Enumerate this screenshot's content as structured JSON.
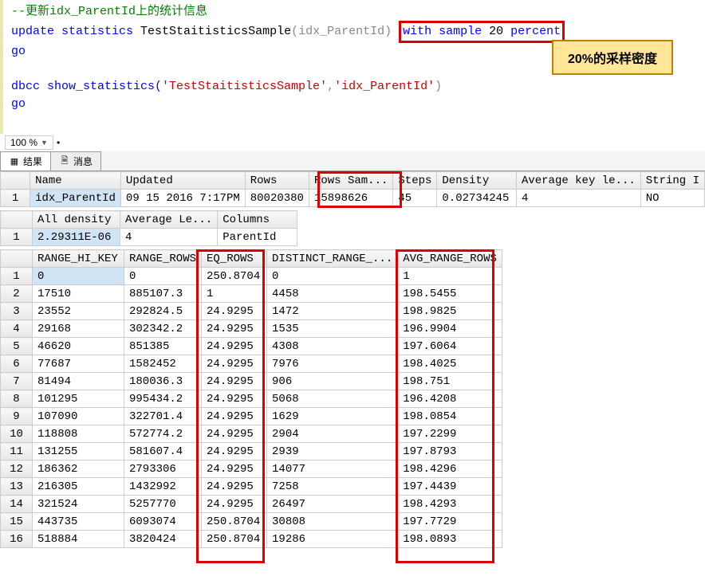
{
  "code": {
    "comment": "--更新idx_ParentId上的统计信息",
    "l2_a": "update",
    "l2_b": " statistics",
    "l2_c": " TestStaitisticsSample",
    "l2_d": "(idx_ParentId) ",
    "l2_box_a": "with",
    "l2_box_b": " sample ",
    "l2_box_c": "20",
    "l2_box_d": " percent",
    "go1": "go",
    "l4_a": "dbcc show_statistics(",
    "l4_b": "'TestStaitisticsSample'",
    "l4_c": ",",
    "l4_d": "'idx_ParentId'",
    "l4_e": ")",
    "go2": "go"
  },
  "annotation": "20%的采样密度",
  "zoom": "100 %",
  "tabs": {
    "results": "结果",
    "messages": "消息"
  },
  "grid1": {
    "headers": [
      "Name",
      "Updated",
      "Rows",
      "Rows Sam...",
      "Steps",
      "Density",
      "Average key le...",
      "String I"
    ],
    "row": [
      "idx_ParentId",
      "09 15 2016  7:17PM",
      "80020380",
      "15898626",
      "45",
      "0.02734245",
      "4",
      "NO"
    ]
  },
  "grid2": {
    "headers": [
      "All density",
      "Average Le...",
      "Columns"
    ],
    "row": [
      "2.29311E-06",
      "4",
      "ParentId"
    ]
  },
  "grid3": {
    "headers": [
      "RANGE_HI_KEY",
      "RANGE_ROWS",
      "EQ_ROWS",
      "DISTINCT_RANGE_...",
      "AVG_RANGE_ROWS"
    ],
    "rows": [
      [
        "0",
        "0",
        "250.8704",
        "0",
        "1"
      ],
      [
        "17510",
        "885107.3",
        "1",
        "4458",
        "198.5455"
      ],
      [
        "23552",
        "292824.5",
        "24.9295",
        "1472",
        "198.9825"
      ],
      [
        "29168",
        "302342.2",
        "24.9295",
        "1535",
        "196.9904"
      ],
      [
        "46620",
        "851385",
        "24.9295",
        "4308",
        "197.6064"
      ],
      [
        "77687",
        "1582452",
        "24.9295",
        "7976",
        "198.4025"
      ],
      [
        "81494",
        "180036.3",
        "24.9295",
        "906",
        "198.751"
      ],
      [
        "101295",
        "995434.2",
        "24.9295",
        "5068",
        "196.4208"
      ],
      [
        "107090",
        "322701.4",
        "24.9295",
        "1629",
        "198.0854"
      ],
      [
        "118808",
        "572774.2",
        "24.9295",
        "2904",
        "197.2299"
      ],
      [
        "131255",
        "581607.4",
        "24.9295",
        "2939",
        "197.8793"
      ],
      [
        "186362",
        "2793306",
        "24.9295",
        "14077",
        "198.4296"
      ],
      [
        "216305",
        "1432992",
        "24.9295",
        "7258",
        "197.4439"
      ],
      [
        "321524",
        "5257770",
        "24.9295",
        "26497",
        "198.4293"
      ],
      [
        "443735",
        "6093074",
        "250.8704",
        "30808",
        "197.7729"
      ],
      [
        "518884",
        "3820424",
        "250.8704",
        "19286",
        "198.0893"
      ]
    ]
  }
}
